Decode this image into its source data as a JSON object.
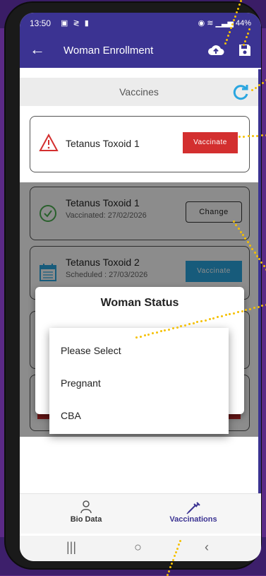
{
  "status_bar": {
    "time": "13:50",
    "battery": "44%"
  },
  "app_bar": {
    "title": "Woman Enrollment"
  },
  "section": {
    "title": "Vaccines"
  },
  "cards": [
    {
      "name": "Tetanus Toxoid 1",
      "sub": "",
      "action": "Vaccinate"
    },
    {
      "name": "Tetanus Toxoid 1",
      "sub": "Vaccinated: 27/02/2026",
      "action": "Change"
    },
    {
      "name": "Tetanus Toxoid 2",
      "sub": "Scheduled : 27/03/2026",
      "action": "Vaccinate"
    }
  ],
  "dialog": {
    "title": "Woman Status",
    "options": [
      "Please Select",
      "Pregnant",
      "CBA"
    ]
  },
  "bottom_nav": [
    {
      "label": "Bio Data",
      "icon": "woman-icon"
    },
    {
      "label": "Vaccinations",
      "icon": "syringe-icon"
    }
  ],
  "colors": {
    "primary": "#3b3392",
    "danger": "#d32f2f",
    "info": "#2aa6e0",
    "success": "#4caf50",
    "annotation": "#f5c000"
  }
}
